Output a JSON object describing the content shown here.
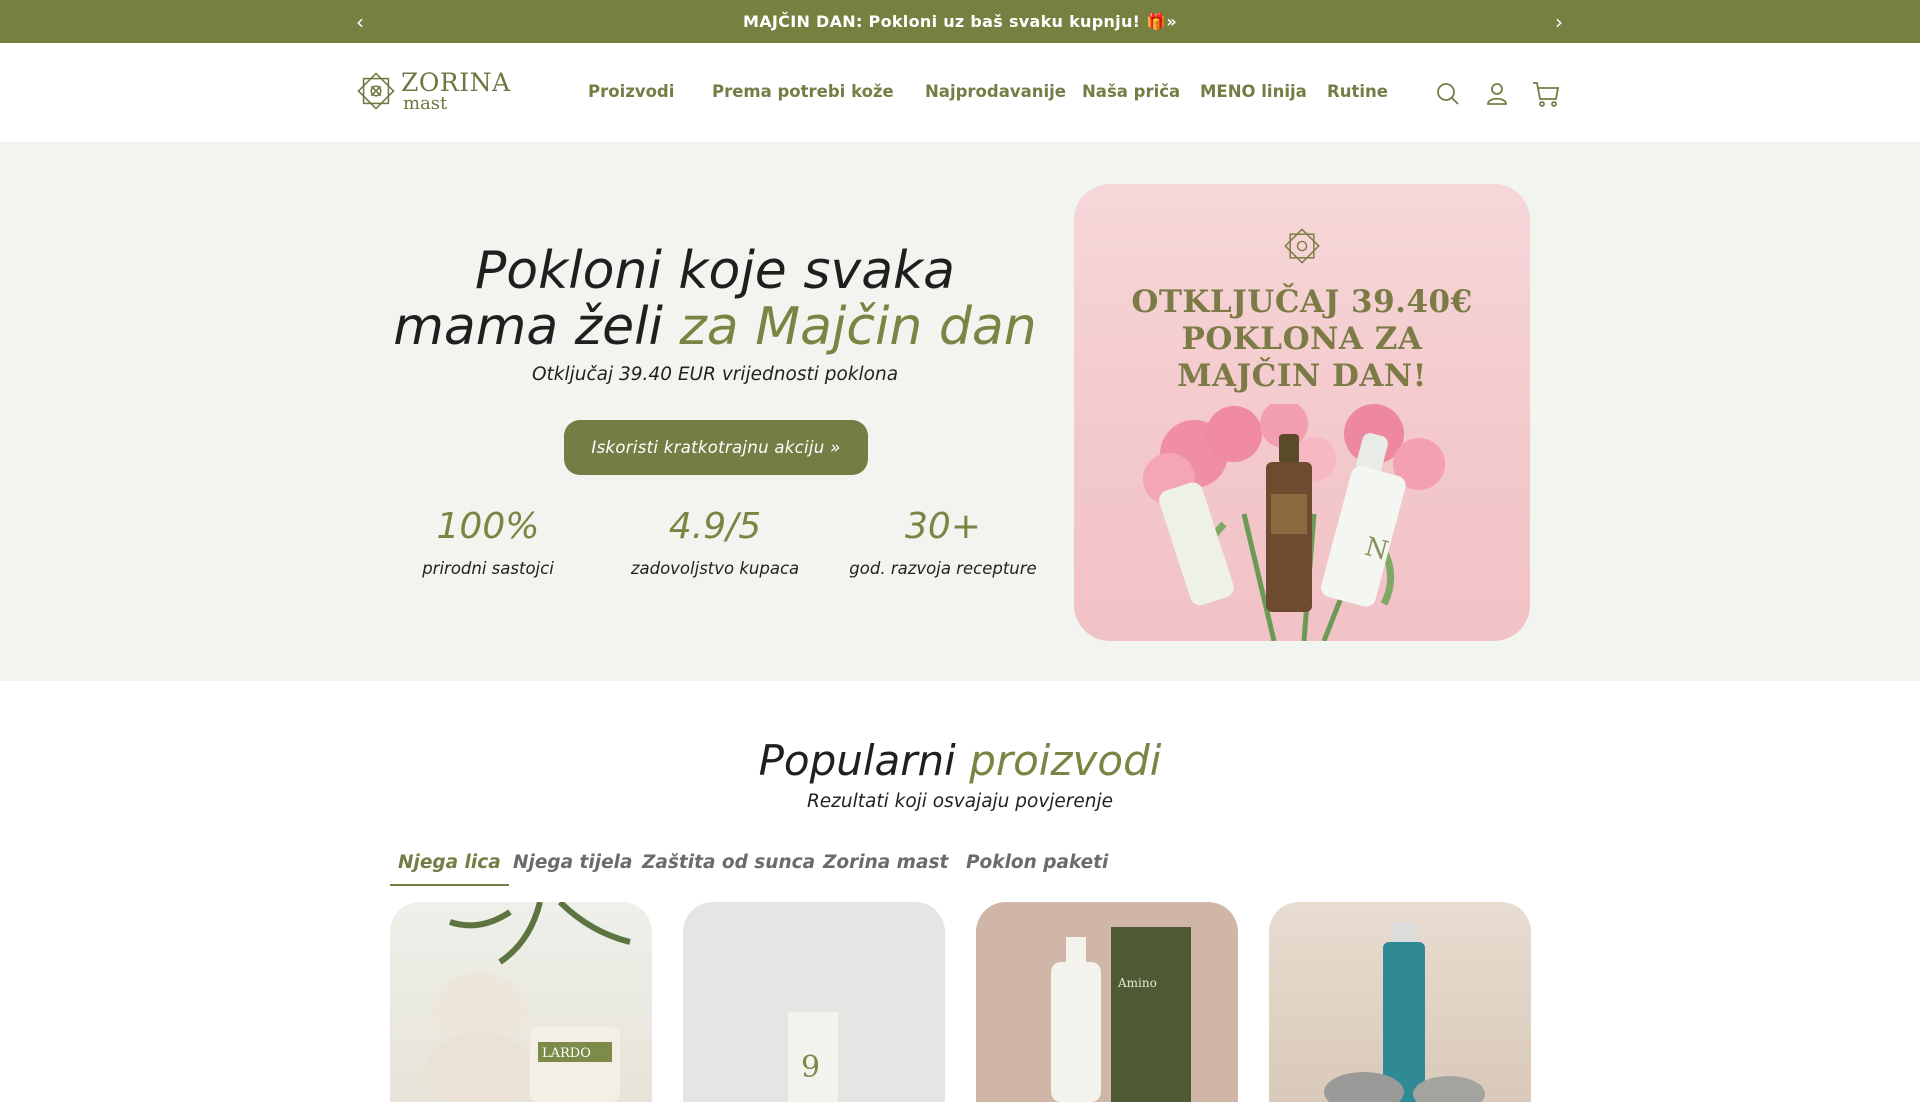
{
  "announcement": {
    "text": "MAJČIN DAN: Pokloni uz baš svaku kupnju! 🎁»",
    "prev_icon": "chevron-left-icon",
    "next_icon": "chevron-right-icon"
  },
  "header": {
    "logo": {
      "line1": "ZORINA",
      "line2": "mast"
    },
    "nav": [
      "Proizvodi",
      "Prema potrebi kože",
      "Najprodavanije",
      "Naša priča",
      "MENO linija",
      "Rutine"
    ],
    "icons": [
      "search-icon",
      "account-icon",
      "cart-icon"
    ]
  },
  "hero": {
    "title_line1": "Pokloni koje svaka",
    "title_line2_plain": "mama želi ",
    "title_line2_accent": "za Majčin dan",
    "subtitle": "Otključaj 39.40 EUR vrijednosti poklona",
    "cta": "Iskoristi kratkotrajnu akciju »",
    "stats": [
      {
        "value": "100%",
        "label": "prirodni sastojci"
      },
      {
        "value": "4.9/5",
        "label": "zadovoljstvo kupaca"
      },
      {
        "value": "30+",
        "label": "god. razvoja recepture"
      }
    ],
    "image_text": [
      "OTKLJUČAJ  39.40€",
      "POKLONA ZA",
      "MAJČIN DAN!"
    ]
  },
  "popular": {
    "title_plain": "Popularni ",
    "title_accent": "proizvodi",
    "subtitle": "Rezultati koji osvajaju povjerenje",
    "tabs": [
      "Njega lica",
      "Njega tijela",
      "Zaštita od sunca",
      "Zorina mast",
      "Poklon paketi"
    ],
    "active_tab": "Njega lica"
  },
  "colors": {
    "brand_green": "#778041",
    "hero_bg": "#f2f4ef",
    "promo_pink": "#f3c9cc"
  }
}
